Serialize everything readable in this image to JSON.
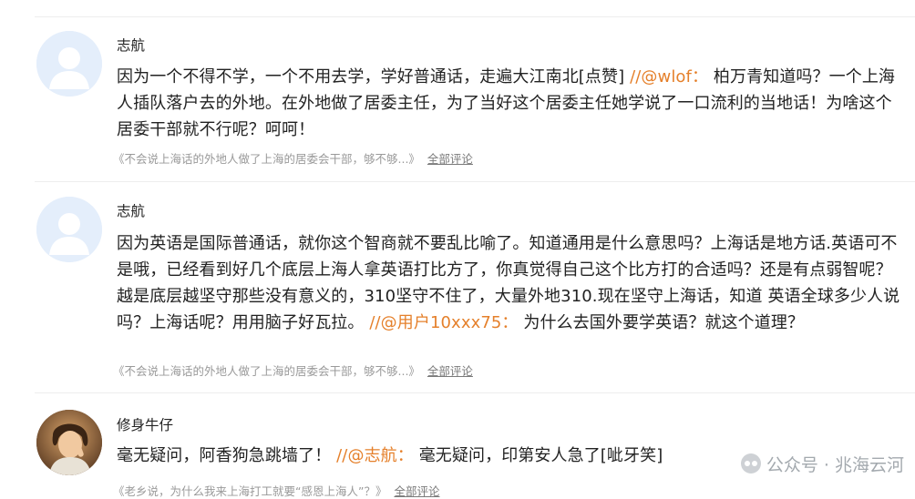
{
  "comments": [
    {
      "username": "志航",
      "avatar_icon": "default-user-avatar-icon",
      "text": "因为一个不得不学，一个不用去学，学好普通话，走遍大江南北[点赞]",
      "reply_ref": "//@wlof：",
      "reply_text": "柏万青知道吗？一个上海人插队落户去的外地。在外地做了居委主任，为了当好这个居委主任她学说了一口流利的当地话！为啥这个居委干部就不行呢？呵呵！",
      "source": "《不会说上海话的外地人做了上海的居委会干部，够不够...》",
      "all_comments": "全部评论"
    },
    {
      "username": "志航",
      "avatar_icon": "default-user-avatar-icon",
      "text": "因为英语是国际普通话，就你这个智商就不要乱比喻了。知道通用是什么意思吗？上海话是地方话.英语可不是哦，已经看到好几个底层上海人拿英语打比方了，你真觉得自己这个比方打的合适吗？还是有点弱智呢？越是底层越坚守那些没有意义的，310坚守不住了，大量外地310.现在坚守上海话，知道 英语全球多少人说吗？上海话呢？用用脑子好瓦拉。",
      "reply_ref": "//@用户10xxx75：",
      "reply_text": "为什么去国外要学英语？就这个道理？",
      "source": "《不会说上海话的外地人做了上海的居委会干部，够不够...》",
      "all_comments": "全部评论"
    },
    {
      "username": "修身牛仔",
      "avatar_icon": "user-photo-avatar-icon",
      "text": "毫无疑问，阿香狗急跳墙了！",
      "reply_ref": "//@志航：",
      "reply_text": "毫无疑问，印第安人急了[呲牙笑]",
      "source": "《老乡说，为什么我来上海打工就要“感恩上海人”？》",
      "all_comments": "全部评论"
    }
  ],
  "watermark": {
    "text": "公众号 · 兆海云河",
    "icon": "wechat-icon"
  },
  "colors": {
    "reply_accent": "#e5802b",
    "footer_gray": "#9a9a9a",
    "avatar_bg": "#e4eefb"
  }
}
